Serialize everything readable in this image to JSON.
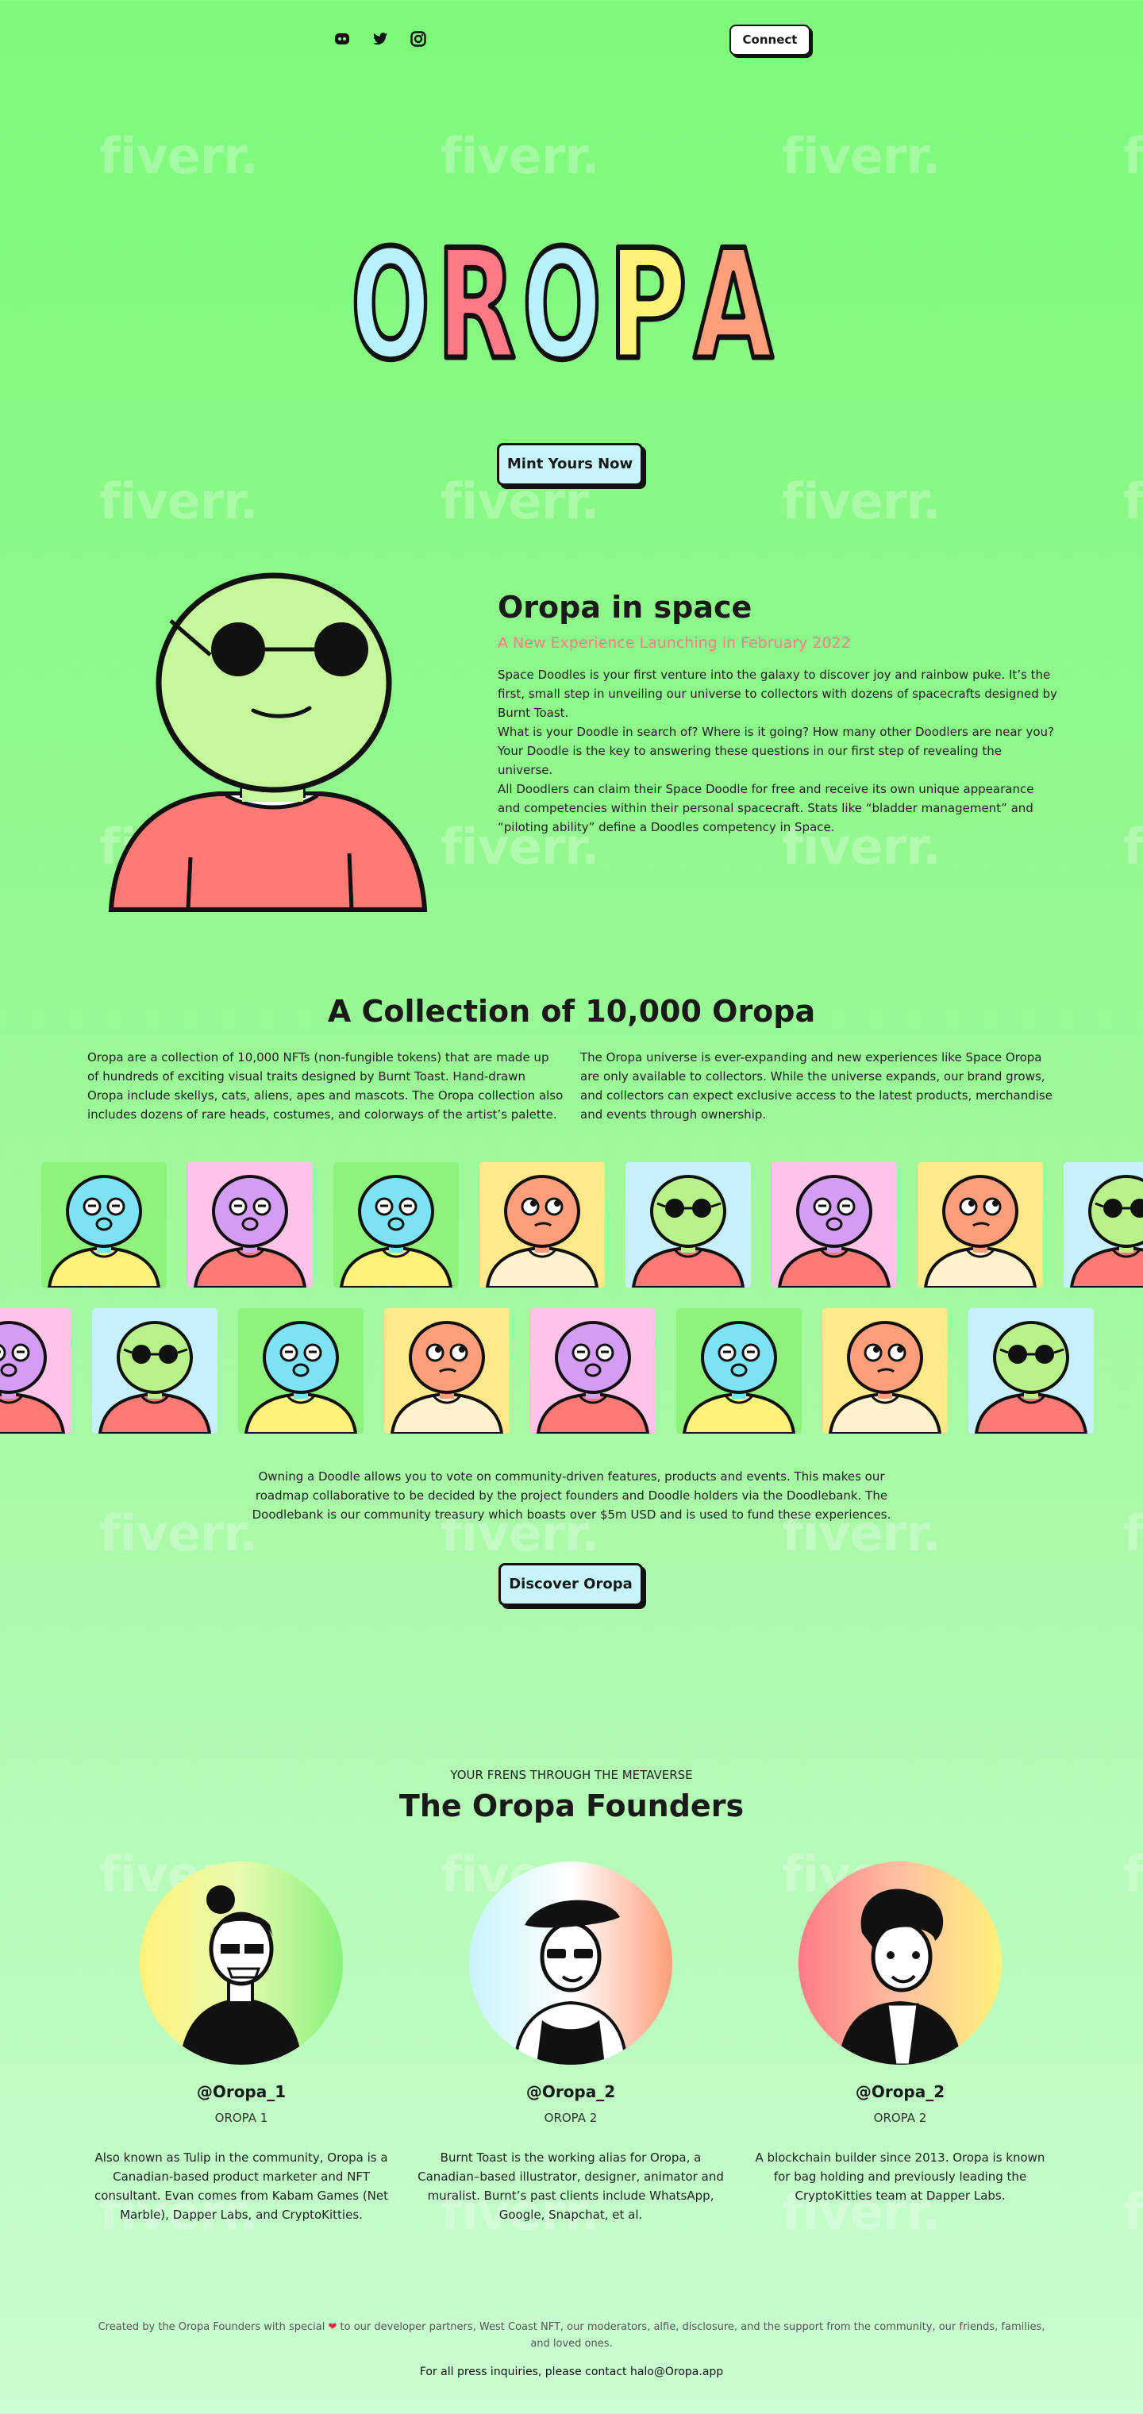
{
  "header": {
    "social_icons": [
      "discord-icon",
      "twitter-icon",
      "instagram-icon"
    ],
    "connect_label": "Connect"
  },
  "hero": {
    "logo_text": "OROPA",
    "logo_letter_colors": [
      "#b9f1fb",
      "#ff7a86",
      "#b9f1fb",
      "#fff27a",
      "#ff9e7a"
    ],
    "mint_label": "Mint Yours Now"
  },
  "watermark": "fiverr.",
  "space": {
    "title": "Oropa in space",
    "subtitle": "A New Experience Launching in February 2022",
    "paragraphs": [
      "Space Doodles is your first venture into the galaxy to discover joy and rainbow puke. It’s the first, small step in unveiling our universe to collectors with dozens of spacecrafts designed by Burnt Toast.",
      "What is your Doodle in search of? Where is it going? How many other Doodlers are near you? Your Doodle is the key to answering these questions in our first step of revealing the universe.",
      "All Doodlers can claim their Space Doodle for free and receive its own unique appearance and competencies within their personal spacecraft. Stats like “bladder management” and “piloting ability” define a Doodles competency in Space."
    ]
  },
  "collection": {
    "title": "A Collection of 10,000 Oropa",
    "left_text": "Oropa are a collection of 10,000 NFTs (non-fungible tokens) that are made up of hundreds of exciting visual traits designed by Burnt Toast. Hand-drawn Oropa include skellys, cats, aliens, apes and mascots. The Oropa collection also includes dozens of rare heads, costumes, and colorways of the artist’s palette.",
    "right_text": "The Oropa universe is ever-expanding and new experiences like Space Oropa are only available to collectors. While the universe expands, our brand grows, and collectors can expect exclusive access to the latest products, merchandise and events through ownership.",
    "governance_text": "Owning a Doodle allows you to vote on community-driven features, products and events. This makes our roadmap collaborative to be decided by the project founders and Doodle holders via the Doodlebank. The Doodlebank is our community treasury which boasts over $5m USD and is used to fund these experiences.",
    "discover_label": "Discover Oropa"
  },
  "founders": {
    "eyebrow": "YOUR FRENS THROUGH THE METAVERSE",
    "title": "The Oropa Founders",
    "people": [
      {
        "handle": "@Oropa_1",
        "role": "OROPA 1",
        "bio": "Also known as Tulip in the community, Oropa is a Canadian-based product marketer and NFT consultant. Evan comes from Kabam Games (Net Marble), Dapper Labs, and CryptoKitties."
      },
      {
        "handle": "@Oropa_2",
        "role": "OROPA 2",
        "bio": "Burnt Toast is the working alias for Oropa, a Canadian–based illustrator, designer, animator and muralist. Burnt’s past clients include WhatsApp, Google, Snapchat, et al."
      },
      {
        "handle": "@Oropa_2",
        "role": "OROPA 2",
        "bio": "A blockchain builder since 2013. Oropa is known for bag holding and previously leading the CryptoKitties team at Dapper Labs."
      }
    ]
  },
  "footer": {
    "credits_before": "Created by the Oropa Founders with special",
    "credits_after": "to our developer partners, West Coast NFT, our moderators, alfie, disclosure, and the support from the community, our friends, families, and loved ones.",
    "press": "For all press inquiries, please contact halo@Oropa.app"
  }
}
